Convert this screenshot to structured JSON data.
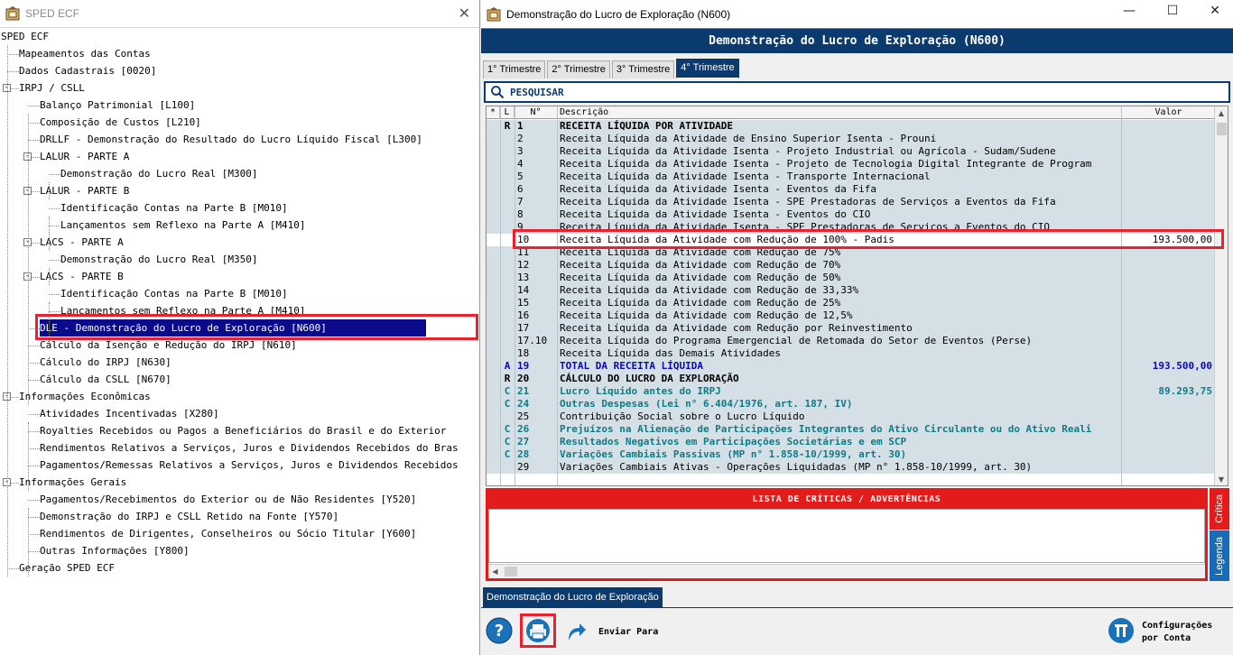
{
  "left_window": {
    "title": "SPED ECF",
    "tree": [
      {
        "label": "SPED ECF"
      },
      {
        "label": "Mapeamentos das Contas"
      },
      {
        "label": "Dados Cadastrais [0020]"
      },
      {
        "label": "IRPJ / CSLL",
        "toggle": "-"
      },
      {
        "label": "Balanço Patrimonial [L100]"
      },
      {
        "label": "Composição de Custos [L210]"
      },
      {
        "label": "DRLLF - Demonstração do Resultado do Lucro Líquido Fiscal [L300]"
      },
      {
        "label": "LALUR - PARTE A",
        "toggle": "-"
      },
      {
        "label": "Demonstração do Lucro Real [M300]"
      },
      {
        "label": "LALUR - PARTE B",
        "toggle": "-"
      },
      {
        "label": "Identificação Contas na Parte B [M010]"
      },
      {
        "label": "Lançamentos sem Reflexo na Parte A [M410]"
      },
      {
        "label": "LACS - PARTE A",
        "toggle": "-"
      },
      {
        "label": "Demonstração do Lucro Real [M350]"
      },
      {
        "label": "LACS - PARTE B",
        "toggle": "-"
      },
      {
        "label": "Identificação Contas na Parte B [M010]"
      },
      {
        "label": "Lançamentos sem Reflexo na Parte A [M410]"
      },
      {
        "label": "DLE - Demonstração do Lucro de Exploração [N600]",
        "selected": true
      },
      {
        "label": "Cálculo da Isenção e Redução do IRPJ [N610]"
      },
      {
        "label": "Cálculo do IRPJ [N630]"
      },
      {
        "label": "Cálculo da CSLL [N670]"
      },
      {
        "label": "Informações Econômicas",
        "toggle": "-"
      },
      {
        "label": "Atividades Incentivadas [X280]"
      },
      {
        "label": "Royalties Recebidos ou Pagos a Beneficiários do Brasil e do Exterior"
      },
      {
        "label": "Rendimentos Relativos a Serviços, Juros e Dividendos Recebidos do Bras"
      },
      {
        "label": "Pagamentos/Remessas Relativos a Serviços, Juros e Dividendos Recebidos"
      },
      {
        "label": "Informações Gerais",
        "toggle": "-"
      },
      {
        "label": "Pagamentos/Recebimentos do Exterior ou de Não Residentes [Y520]"
      },
      {
        "label": "Demonstração do IRPJ e CSLL Retido na Fonte [Y570]"
      },
      {
        "label": "Rendimentos de Dirigentes, Conselheiros ou Sócio Titular [Y600]"
      },
      {
        "label": "Outras Informações [Y800]"
      },
      {
        "label": "Geração SPED ECF"
      }
    ]
  },
  "right_window": {
    "title": "Demonstração do Lucro de Exploração (N600)",
    "banner": "Demonstração do Lucro de Exploração (N600)",
    "tabs": [
      "1° Trimestre",
      "2° Trimestre",
      "3° Trimestre",
      "4° Trimestre"
    ],
    "search_label": "PESQUISAR",
    "columns": {
      "star": "*",
      "l": "L",
      "n": "N°",
      "desc": "Descrição",
      "valor": "Valor"
    },
    "rows": [
      {
        "l": "R",
        "n": "1",
        "d": "RECEITA LÍQUIDA POR ATIVIDADE",
        "v": "",
        "style": "bold"
      },
      {
        "l": "",
        "n": "2",
        "d": "Receita Líquida da Atividade de Ensino Superior Isenta - Prouni",
        "v": ""
      },
      {
        "l": "",
        "n": "3",
        "d": "Receita Líquida da Atividade Isenta - Projeto Industrial ou Agrícola - Sudam/Sudene",
        "v": ""
      },
      {
        "l": "",
        "n": "4",
        "d": "Receita Líquida da Atividade Isenta - Projeto de Tecnologia Digital Integrante de Program",
        "v": ""
      },
      {
        "l": "",
        "n": "5",
        "d": "Receita Líquida da Atividade Isenta - Transporte Internacional",
        "v": ""
      },
      {
        "l": "",
        "n": "6",
        "d": "Receita Líquida da Atividade Isenta - Eventos da Fifa",
        "v": ""
      },
      {
        "l": "",
        "n": "7",
        "d": "Receita Líquida da Atividade Isenta - SPE Prestadoras de Serviços a Eventos da Fifa",
        "v": ""
      },
      {
        "l": "",
        "n": "8",
        "d": "Receita Líquida da Atividade Isenta - Eventos do CIO",
        "v": ""
      },
      {
        "l": "",
        "n": "9",
        "d": "Receita Líquida da Atividade Isenta - SPE Prestadoras de Serviços a Eventos do CIO",
        "v": ""
      },
      {
        "l": "",
        "n": "10",
        "d": "Receita Líquida da Atividade com Redução de 100% - Padis",
        "v": "193.500,00",
        "style": "current"
      },
      {
        "l": "",
        "n": "11",
        "d": "Receita Líquida da Atividade com Redução de 75%",
        "v": ""
      },
      {
        "l": "",
        "n": "12",
        "d": "Receita Líquida da Atividade com Redução de 70%",
        "v": ""
      },
      {
        "l": "",
        "n": "13",
        "d": "Receita Líquida da Atividade com Redução de 50%",
        "v": ""
      },
      {
        "l": "",
        "n": "14",
        "d": "Receita Líquida da Atividade com Redução de 33,33%",
        "v": ""
      },
      {
        "l": "",
        "n": "15",
        "d": "Receita Líquida da Atividade com Redução de 25%",
        "v": ""
      },
      {
        "l": "",
        "n": "16",
        "d": "Receita Líquida da Atividade com Redução de 12,5%",
        "v": ""
      },
      {
        "l": "",
        "n": "17",
        "d": "Receita Líquida da Atividade com Redução por Reinvestimento",
        "v": ""
      },
      {
        "l": "",
        "n": "17.10",
        "d": "Receita Líquida do Programa Emergencial de Retomada do Setor de Eventos (Perse)",
        "v": ""
      },
      {
        "l": "",
        "n": "18",
        "d": "Receita Líquida das Demais Atividades",
        "v": ""
      },
      {
        "l": "A",
        "n": "19",
        "d": "TOTAL DA RECEITA LÍQUIDA",
        "v": "193.500,00",
        "style": "total"
      },
      {
        "l": "R",
        "n": "20",
        "d": "CÁLCULO DO LUCRO DA EXPLORAÇÃO",
        "v": "",
        "style": "bold"
      },
      {
        "l": "C",
        "n": "21",
        "d": "Lucro Líquido antes do IRPJ",
        "v": "89.293,75",
        "style": "calc"
      },
      {
        "l": "C",
        "n": "24",
        "d": "Outras Despesas (Lei n° 6.404/1976, art. 187, IV)",
        "v": "",
        "style": "calc"
      },
      {
        "l": "",
        "n": "25",
        "d": "Contribuição Social sobre o Lucro Líquido",
        "v": ""
      },
      {
        "l": "C",
        "n": "26",
        "d": "Prejuízos na Alienação de Participações Integrantes do Ativo Circulante ou do Ativo Reali",
        "v": "",
        "style": "calc"
      },
      {
        "l": "C",
        "n": "27",
        "d": "Resultados Negativos em Participações Societárias e em SCP",
        "v": "",
        "style": "calc"
      },
      {
        "l": "C",
        "n": "28",
        "d": "Variações Cambiais Passivas (MP n° 1.858-10/1999, art. 30)",
        "v": "",
        "style": "calc"
      },
      {
        "l": "",
        "n": "29",
        "d": "Variações Cambiais Ativas - Operações Liquidadas (MP n° 1.858-10/1999, art. 30)",
        "v": ""
      }
    ],
    "errors_title": "LISTA DE CRÍTICAS / ADVERTÊNCIAS",
    "side_tabs": {
      "critica": "Crítica",
      "legenda": "Legenda"
    },
    "bottom_tab": "Demonstração do Lucro de Exploração",
    "toolbar": {
      "send_label": "Enviar Para",
      "config_label_1": "Configurações",
      "config_label_2": "por Conta"
    }
  },
  "colors": {
    "navy": "#0b3a6e",
    "highlight_red": "#e8222e",
    "row_bg": "#d5dfe6",
    "calc_text": "#0e7c86",
    "total_text": "#0a0ab4"
  }
}
